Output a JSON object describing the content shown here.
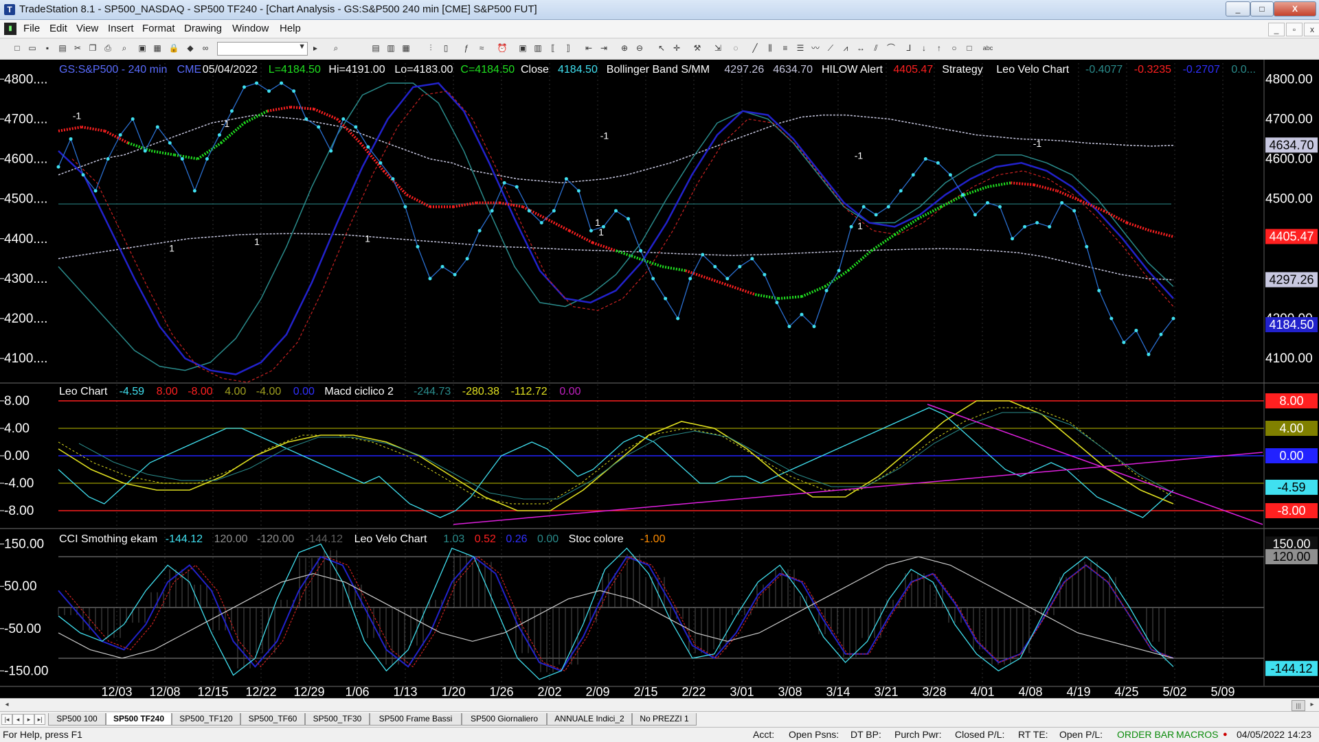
{
  "window": {
    "title": "TradeStation 8.1 - SP500_NASDAQ - SP500 TF240 - [Chart Analysis - GS:S&P500  240 min  [CME] S&P500 FUT]",
    "app_icon": "tradestation-logo-icon"
  },
  "menu": [
    "File",
    "Edit",
    "View",
    "Insert",
    "Format",
    "Drawing",
    "Window",
    "Help"
  ],
  "colors": {
    "background": "#000000",
    "price_bars": "#40e0f0",
    "band_blue": "#2222cc",
    "band_red": "#cc2222",
    "band_teal": "#2a8c8c",
    "ma_white": "#c8c8e0",
    "trail_red": "#ff2020",
    "trail_green": "#20e020",
    "leo_cyan": "#40e0f0",
    "leo_yellow": "#e0e020",
    "trend_magenta": "#e020e0",
    "grid_line": "#303030"
  },
  "header1": [
    {
      "text": "GS:S&P500 - 240 min",
      "color": "#5a6cff"
    },
    {
      "text": "CME",
      "color": "#5a6cff"
    },
    {
      "text": "05/04/2022",
      "color": "#ffffff"
    },
    {
      "text": "L=4184.50",
      "color": "#20e020"
    },
    {
      "text": "Hi=4191.00",
      "color": "#ffffff"
    },
    {
      "text": "Lo=4183.00",
      "color": "#ffffff"
    },
    {
      "text": "C=4184.50",
      "color": "#20e020"
    },
    {
      "text": "Close",
      "color": "#ffffff"
    },
    {
      "text": "4184.50",
      "color": "#40e0f0"
    },
    {
      "text": "Bollinger Band S/MM",
      "color": "#ffffff"
    },
    {
      "text": "4297.26",
      "color": "#c8c8e0"
    },
    {
      "text": "4634.70",
      "color": "#c8c8e0"
    },
    {
      "text": "HILOW Alert",
      "color": "#ffffff"
    },
    {
      "text": "4405.47",
      "color": "#ff2020"
    },
    {
      "text": "Strategy",
      "color": "#ffffff"
    },
    {
      "text": "Leo Velo Chart",
      "color": "#ffffff"
    },
    {
      "text": "-0.4077",
      "color": "#2a8c8c"
    },
    {
      "text": "-0.3235",
      "color": "#ff2020"
    },
    {
      "text": "-0.2707",
      "color": "#3030ff"
    },
    {
      "text": "0.0...",
      "color": "#2a8c8c"
    }
  ],
  "header2": [
    {
      "text": "Leo Chart",
      "color": "#ffffff"
    },
    {
      "text": "-4.59",
      "color": "#40e0f0"
    },
    {
      "text": "8.00",
      "color": "#ff2020"
    },
    {
      "text": "-8.00",
      "color": "#ff2020"
    },
    {
      "text": "4.00",
      "color": "#a0a020"
    },
    {
      "text": "-4.00",
      "color": "#a0a020"
    },
    {
      "text": "0.00",
      "color": "#3030ff"
    },
    {
      "text": "Macd ciclico 2",
      "color": "#ffffff"
    },
    {
      "text": "-244.73",
      "color": "#2a8c8c"
    },
    {
      "text": "-280.38",
      "color": "#e0e020"
    },
    {
      "text": "-112.72",
      "color": "#e0e020"
    },
    {
      "text": "0.00",
      "color": "#c020c0"
    }
  ],
  "header3": [
    {
      "text": "CCI Smothing ekam",
      "color": "#ffffff"
    },
    {
      "text": "-144.12",
      "color": "#40e0f0"
    },
    {
      "text": "120.00",
      "color": "#909090"
    },
    {
      "text": "-120.00",
      "color": "#909090"
    },
    {
      "text": "-144.12",
      "color": "#606060"
    },
    {
      "text": "Leo Velo Chart",
      "color": "#ffffff"
    },
    {
      "text": "1.03",
      "color": "#2a8c8c"
    },
    {
      "text": "0.52",
      "color": "#ff2020"
    },
    {
      "text": "0.26",
      "color": "#3030ff"
    },
    {
      "text": "0.00",
      "color": "#2a8c8c"
    },
    {
      "text": "Stoc colore",
      "color": "#ffffff"
    },
    {
      "text": "-1.00",
      "color": "#ff8c00"
    }
  ],
  "chart_data": [
    {
      "type": "line",
      "title": "GS:S&P500 - 240 min",
      "ylim": [
        4040,
        4840
      ],
      "y_ticks": [
        "4800....",
        "4700....",
        "4600....",
        "4500....",
        "4400....",
        "4300....",
        "4200....",
        "4100...."
      ],
      "right_ticks": [
        "4800.00",
        "4700.00",
        "4600.00",
        "4500.00",
        "4400.00",
        "4300.00",
        "4200.00",
        "4100.00"
      ],
      "x_labels": [
        "12/03",
        "12/08",
        "12/15",
        "12/22",
        "12/29",
        "1/06",
        "1/13",
        "1/20",
        "1/26",
        "2/02",
        "2/09",
        "2/15",
        "2/22",
        "3/01",
        "3/08",
        "3/14",
        "3/21",
        "3/28",
        "4/01",
        "4/08",
        "4/19",
        "4/25",
        "5/02",
        "5/09"
      ],
      "series": [
        {
          "values": [
            4580,
            4650,
            4560,
            4520,
            4600,
            4660,
            4700,
            4620,
            4680,
            4640,
            4600,
            4520,
            4600,
            4660,
            4720,
            4780,
            4790,
            4770,
            4790,
            4770,
            4700,
            4680,
            4620,
            4700,
            4680,
            4630,
            4590,
            4550,
            4480,
            4380,
            4300,
            4330,
            4310,
            4350,
            4420,
            4470,
            4540,
            4530,
            4470,
            4440,
            4470,
            4550,
            4520,
            4420,
            4430,
            4470,
            4450,
            4370,
            4300,
            4250,
            4200,
            4300,
            4360,
            4330,
            4300,
            4330,
            4350,
            4310,
            4240,
            4180,
            4210,
            4180,
            4270,
            4320,
            4430,
            4480,
            4460,
            4480,
            4520,
            4560,
            4600,
            4590,
            4560,
            4510,
            4460,
            4490,
            4480,
            4400,
            4430,
            4440,
            4430,
            4490,
            4470,
            4380,
            4270,
            4200,
            4140,
            4170,
            4110,
            4160,
            4200
          ]
        },
        {
          "values": [
            4560,
            4580,
            4600,
            4610,
            4630,
            4650,
            4670,
            4690,
            4700,
            4710,
            4705,
            4700,
            4690,
            4680,
            4660,
            4640,
            4620,
            4600,
            4590,
            4570,
            4560,
            4550,
            4545,
            4540,
            4545,
            4550,
            4560,
            4575,
            4590,
            4610,
            4630,
            4650,
            4670,
            4690,
            4705,
            4710,
            4710,
            4705,
            4700,
            4690,
            4680,
            4670,
            4660,
            4655,
            4650,
            4648,
            4645,
            4640,
            4637,
            4634,
            4632,
            4634
          ]
        },
        {
          "values": [
            4350,
            4360,
            4370,
            4380,
            4390,
            4400,
            4405,
            4410,
            4412,
            4413,
            4412,
            4410,
            4405,
            4400,
            4395,
            4390,
            4385,
            4380,
            4378,
            4375,
            4372,
            4370,
            4368,
            4365,
            4362,
            4360,
            4358,
            4360,
            4362,
            4365,
            4368,
            4370,
            4372,
            4374,
            4375,
            4374,
            4370,
            4365,
            4355,
            4340,
            4325,
            4310,
            4300,
            4297
          ]
        },
        {
          "values": [
            4330,
            4260,
            4190,
            4120,
            4080,
            4070,
            4090,
            4150,
            4250,
            4380,
            4530,
            4660,
            4760,
            4790,
            4790,
            4740,
            4620,
            4470,
            4330,
            4240,
            4230,
            4260,
            4310,
            4390,
            4500,
            4600,
            4690,
            4720,
            4700,
            4640,
            4560,
            4480,
            4440,
            4440,
            4480,
            4540,
            4580,
            4610,
            4610,
            4590,
            4560,
            4500,
            4420,
            4340,
            4280
          ]
        },
        {
          "values": [
            4620,
            4560,
            4430,
            4300,
            4180,
            4100,
            4070,
            4060,
            4090,
            4160,
            4290,
            4440,
            4580,
            4700,
            4780,
            4790,
            4720,
            4590,
            4450,
            4320,
            4250,
            4240,
            4270,
            4340,
            4440,
            4560,
            4660,
            4720,
            4710,
            4650,
            4570,
            4490,
            4440,
            4430,
            4460,
            4510,
            4550,
            4580,
            4590,
            4570,
            4530,
            4470,
            4400,
            4320,
            4250
          ]
        },
        {
          "values": [
            4670,
            4680,
            4670,
            4640,
            4620,
            4610,
            4600,
            4640,
            4690,
            4720,
            4730,
            4725,
            4700,
            4640,
            4570,
            4510,
            4480,
            4480,
            4490,
            4490,
            4480,
            4450,
            4420,
            4390,
            4370,
            4350,
            4330,
            4320,
            4300,
            4280,
            4260,
            4250,
            4255,
            4280,
            4320,
            4370,
            4410,
            4450,
            4480,
            4510,
            4530,
            4540,
            4535,
            4520,
            4495,
            4470,
            4440,
            4420,
            4405
          ]
        }
      ],
      "signals": [
        "-1",
        "1",
        "-1",
        "1",
        "1",
        "-1",
        "1",
        "-1",
        "1",
        "1",
        "-1"
      ],
      "markers": [
        {
          "label": "4634.70",
          "color": "#c8c8e0",
          "text": "#000000"
        },
        {
          "label": "4405.47",
          "color": "#ff2020",
          "text": "#ffffff"
        },
        {
          "label": "4297.26",
          "color": "#c8c8e0",
          "text": "#000000"
        },
        {
          "label": "4184.50",
          "color": "#2222cc",
          "text": "#ffffff"
        }
      ]
    },
    {
      "type": "line",
      "title": "Leo Chart",
      "ylim": [
        -10.5,
        10.5
      ],
      "y_ticks": [
        "8.00",
        "4.00",
        "0.00",
        "-4.00",
        "-8.00"
      ],
      "levels": [
        8,
        4,
        0,
        -4,
        -8
      ],
      "series": [
        {
          "values": [
            -2,
            -4,
            -6,
            -7,
            -5,
            -3,
            -1,
            0,
            1,
            2,
            3,
            4,
            4,
            3,
            2,
            1,
            0,
            -1,
            -2,
            -3,
            -4,
            -3,
            -5,
            -7,
            -8,
            -9,
            -8,
            -6,
            -3,
            0,
            1,
            2,
            1,
            -1,
            -3,
            -2,
            0,
            2,
            3,
            2,
            0,
            -2,
            -4,
            -4,
            -3,
            -3,
            -4,
            -3,
            -2,
            -1,
            0,
            1,
            2,
            3,
            4,
            5,
            6,
            7,
            6,
            4,
            2,
            0,
            -2,
            -3,
            -2,
            -1,
            -2,
            -4,
            -6,
            -7,
            -8,
            -9,
            -7,
            -5
          ]
        },
        {
          "values": [
            1,
            -2,
            -4,
            -5,
            -5,
            -3,
            0,
            2,
            3,
            3,
            2,
            0,
            -3,
            -6,
            -8,
            -8,
            -5,
            -1,
            3,
            5,
            4,
            1,
            -3,
            -6,
            -6,
            -3,
            1,
            5,
            8,
            8,
            6,
            2,
            -2,
            -5,
            -7
          ]
        },
        {
          "values": [
            2,
            -1,
            -3,
            -4,
            -4,
            -2,
            1,
            3,
            3,
            2,
            0,
            -3,
            -6,
            -7,
            -7,
            -4,
            0,
            3,
            4,
            3,
            0,
            -3,
            -5,
            -5,
            -2,
            2,
            5,
            7,
            7,
            5,
            1,
            -3,
            -6
          ]
        }
      ],
      "markers": [
        {
          "label": "8.00",
          "color": "#ff2020",
          "text": "#ffffff"
        },
        {
          "label": "4.00",
          "color": "#808000",
          "text": "#ffffff"
        },
        {
          "label": "0.00",
          "color": "#2222ff",
          "text": "#ffffff"
        },
        {
          "label": "-4.59",
          "color": "#40e0f0",
          "text": "#000000"
        },
        {
          "label": "-8.00",
          "color": "#ff2020",
          "text": "#ffffff"
        }
      ]
    },
    {
      "type": "line",
      "title": "CCI Smothing ekam",
      "ylim": [
        -185,
        185
      ],
      "y_ticks": [
        "150.00",
        "50.00",
        "-50.00",
        "-150.00"
      ],
      "levels": [
        120,
        0,
        -120
      ],
      "series": [
        {
          "values": [
            -20,
            -60,
            -80,
            -40,
            40,
            100,
            60,
            -60,
            -160,
            -120,
            20,
            130,
            150,
            60,
            -80,
            -150,
            -100,
            20,
            140,
            120,
            0,
            -120,
            -170,
            -150,
            -40,
            90,
            140,
            80,
            -30,
            -120,
            -110,
            -20,
            60,
            100,
            30,
            -70,
            -130,
            -80,
            20,
            90,
            60,
            -40,
            -110,
            -150,
            -120,
            -20,
            80,
            120,
            80,
            0,
            -90,
            -140
          ]
        },
        {
          "values": [
            40,
            -20,
            -80,
            -100,
            -40,
            60,
            100,
            40,
            -80,
            -140,
            -80,
            40,
            120,
            100,
            0,
            -100,
            -140,
            -60,
            60,
            120,
            80,
            -40,
            -130,
            -150,
            -70,
            40,
            120,
            100,
            10,
            -90,
            -120,
            -60,
            30,
            80,
            60,
            -30,
            -110,
            -110,
            -20,
            60,
            80,
            10,
            -80,
            -130,
            -110,
            -30,
            60,
            100,
            60,
            -20,
            -100,
            -120
          ]
        },
        {
          "values": [
            -60,
            -100,
            -120,
            -100,
            -60,
            -20,
            20,
            60,
            80,
            60,
            20,
            -20,
            -60,
            -80,
            -60,
            -20,
            20,
            40,
            20,
            -20,
            -60,
            -80,
            -60,
            -20,
            20,
            60,
            100,
            120,
            100,
            60,
            20,
            -20,
            -60,
            -80,
            -100,
            -120
          ]
        }
      ],
      "markers": [
        {
          "label": "150.00",
          "color": "#101010",
          "text": "#ffffff"
        },
        {
          "label": "120.00",
          "color": "#909090",
          "text": "#000000"
        },
        {
          "label": "-144.12",
          "color": "#40e0f0",
          "text": "#000000"
        }
      ]
    }
  ],
  "tabs": {
    "items": [
      "SP500 100",
      "SP500 TF240",
      "SP500_TF120",
      "SP500_TF60",
      "SP500_TF30",
      "SP500 Frame Bassi",
      "SP500 Giornaliero",
      "ANNUALE Indici_2",
      "No PREZZI 1"
    ],
    "active": "SP500 TF240"
  },
  "status": {
    "help": "For Help, press F1",
    "acct": "Acct:",
    "open_psns": "Open Psns:",
    "dt_bp": "DT BP:",
    "purch_pwr": "Purch Pwr:",
    "closed_pl": "Closed P/L:",
    "rt_te": "RT TE:",
    "open_pl": "Open P/L:",
    "order_bar": "ORDER BAR",
    "macros": "MACROS",
    "datetime": "04/05/2022 14:23"
  }
}
